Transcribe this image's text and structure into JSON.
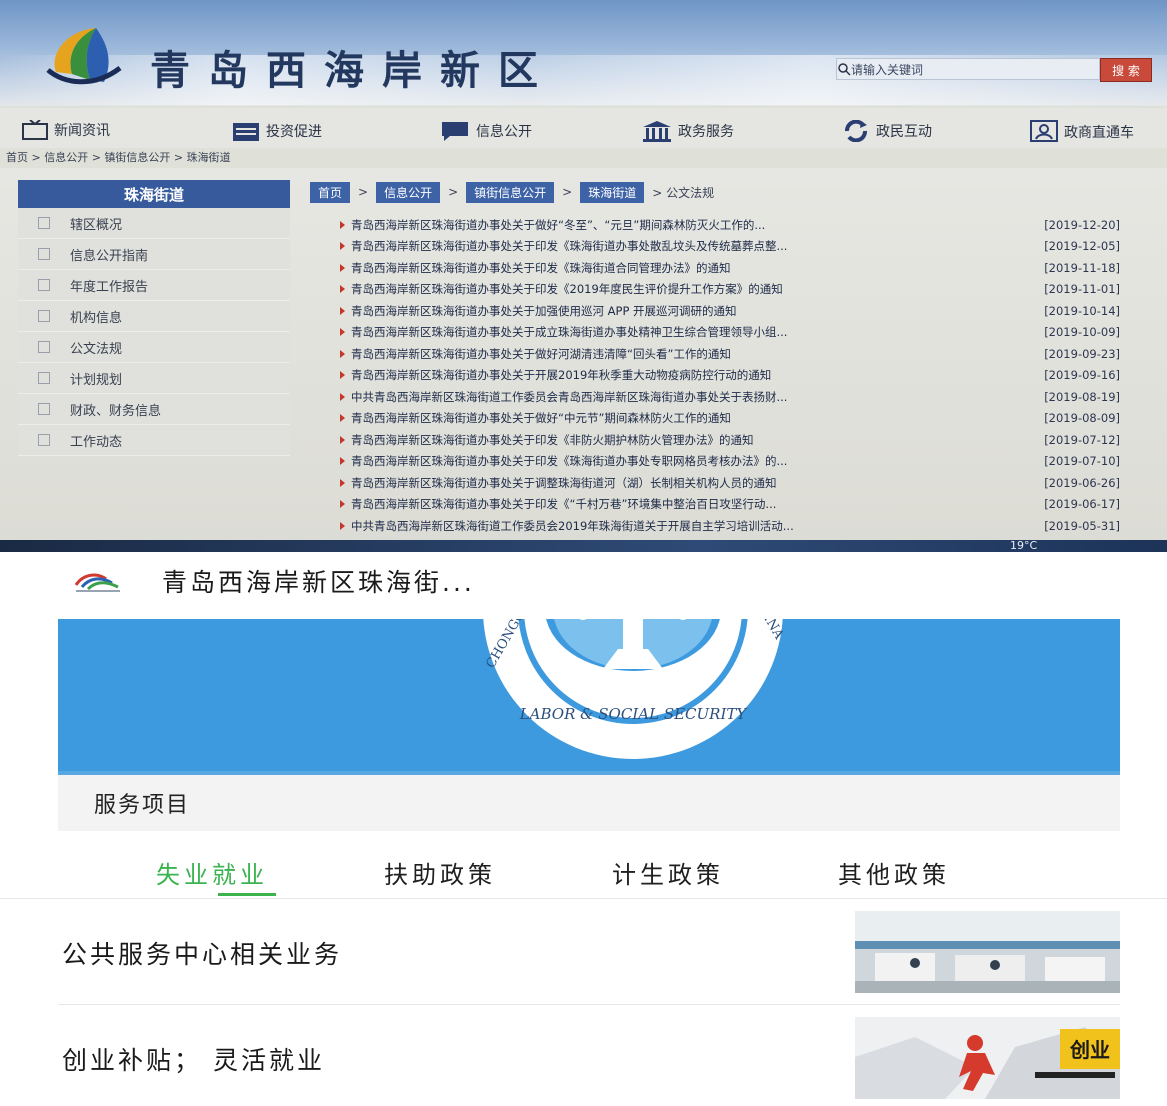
{
  "site": {
    "title": "青岛西海岸新区",
    "search_placeholder": "请输入关键词",
    "search_button": "搜 索",
    "nav": [
      "新闻资讯",
      "投资促进",
      "信息公开",
      "政务服务",
      "政民互动",
      "政商直通车"
    ],
    "breadcrumb_top": "首页 > 信息公开 > 镇街信息公开 > 珠海街道",
    "sidebar": {
      "title": "珠海街道",
      "items": [
        "辖区概况",
        "信息公开指南",
        "年度工作报告",
        "机构信息",
        "公文法规",
        "计划规划",
        "财政、财务信息",
        "工作动态"
      ]
    },
    "crumb_chips": [
      "首页",
      "信息公开",
      "镇街信息公开",
      "珠海街道"
    ],
    "crumb_current": "> 公文法规",
    "rows": [
      {
        "title": "青岛西海岸新区珠海街道办事处关于做好“冬至”、“元旦”期间森林防灭火工作的...",
        "date": "[2019-12-20]"
      },
      {
        "title": "青岛西海岸新区珠海街道办事处关于印发《珠海街道办事处散乱坟头及传统墓葬点整...",
        "date": "[2019-12-05]"
      },
      {
        "title": "青岛西海岸新区珠海街道办事处关于印发《珠海街道合同管理办法》的通知",
        "date": "[2019-11-18]"
      },
      {
        "title": "青岛西海岸新区珠海街道办事处关于印发《2019年度民生评价提升工作方案》的通知",
        "date": "[2019-11-01]"
      },
      {
        "title": "青岛西海岸新区珠海街道办事处关于加强使用巡河 APP 开展巡河调研的通知",
        "date": "[2019-10-14]"
      },
      {
        "title": "青岛西海岸新区珠海街道办事处关于成立珠海街道办事处精神卫生综合管理领导小组...",
        "date": "[2019-10-09]"
      },
      {
        "title": "青岛西海岸新区珠海街道办事处关于做好河湖清违清障“回头看”工作的通知",
        "date": "[2019-09-23]"
      },
      {
        "title": "青岛西海岸新区珠海街道办事处关于开展2019年秋季重大动物疫病防控行动的通知",
        "date": "[2019-09-16]"
      },
      {
        "title": "中共青岛西海岸新区珠海街道工作委员会青岛西海岸新区珠海街道办事处关于表扬财...",
        "date": "[2019-08-19]"
      },
      {
        "title": "青岛西海岸新区珠海街道办事处关于做好“中元节”期间森林防火工作的通知",
        "date": "[2019-08-09]"
      },
      {
        "title": "青岛西海岸新区珠海街道办事处关于印发《非防火期护林防火管理办法》的通知",
        "date": "[2019-07-12]"
      },
      {
        "title": "青岛西海岸新区珠海街道办事处关于印发《珠海街道办事处专职网格员考核办法》的...",
        "date": "[2019-07-10]"
      },
      {
        "title": "青岛西海岸新区珠海街道办事处关于调整珠海街道河（湖）长制相关机构人员的通知",
        "date": "[2019-06-26]"
      },
      {
        "title": "青岛西海岸新区珠海街道办事处关于印发《“千村万巷”环境集中整治百日攻坚行动...",
        "date": "[2019-06-17]"
      },
      {
        "title": "中共青岛西海岸新区珠海街道工作委员会2019年珠海街道关于开展自主学习培训活动...",
        "date": "[2019-05-31]"
      }
    ],
    "temperature": "19°C"
  },
  "mobile": {
    "title": "青岛西海岸新区珠海街...",
    "emblem_text": "LABOR & SOCIAL SECURITY",
    "emblem_side_left": "CHONGQING",
    "emblem_side_right": "CHINA",
    "service_title": "服务项目",
    "tabs": [
      "失业就业",
      "扶助政策",
      "计生政策",
      "其他政策"
    ],
    "items": [
      {
        "label": "公共服务中心相关业务"
      },
      {
        "label": "创业补贴； 灵活就业",
        "thumb_text": "创业"
      }
    ]
  },
  "colors": {
    "nav_blue": "#365a9c",
    "accent_green": "#3bb34f",
    "hero_blue": "#3d9ade",
    "list_marker": "#c5372b"
  }
}
